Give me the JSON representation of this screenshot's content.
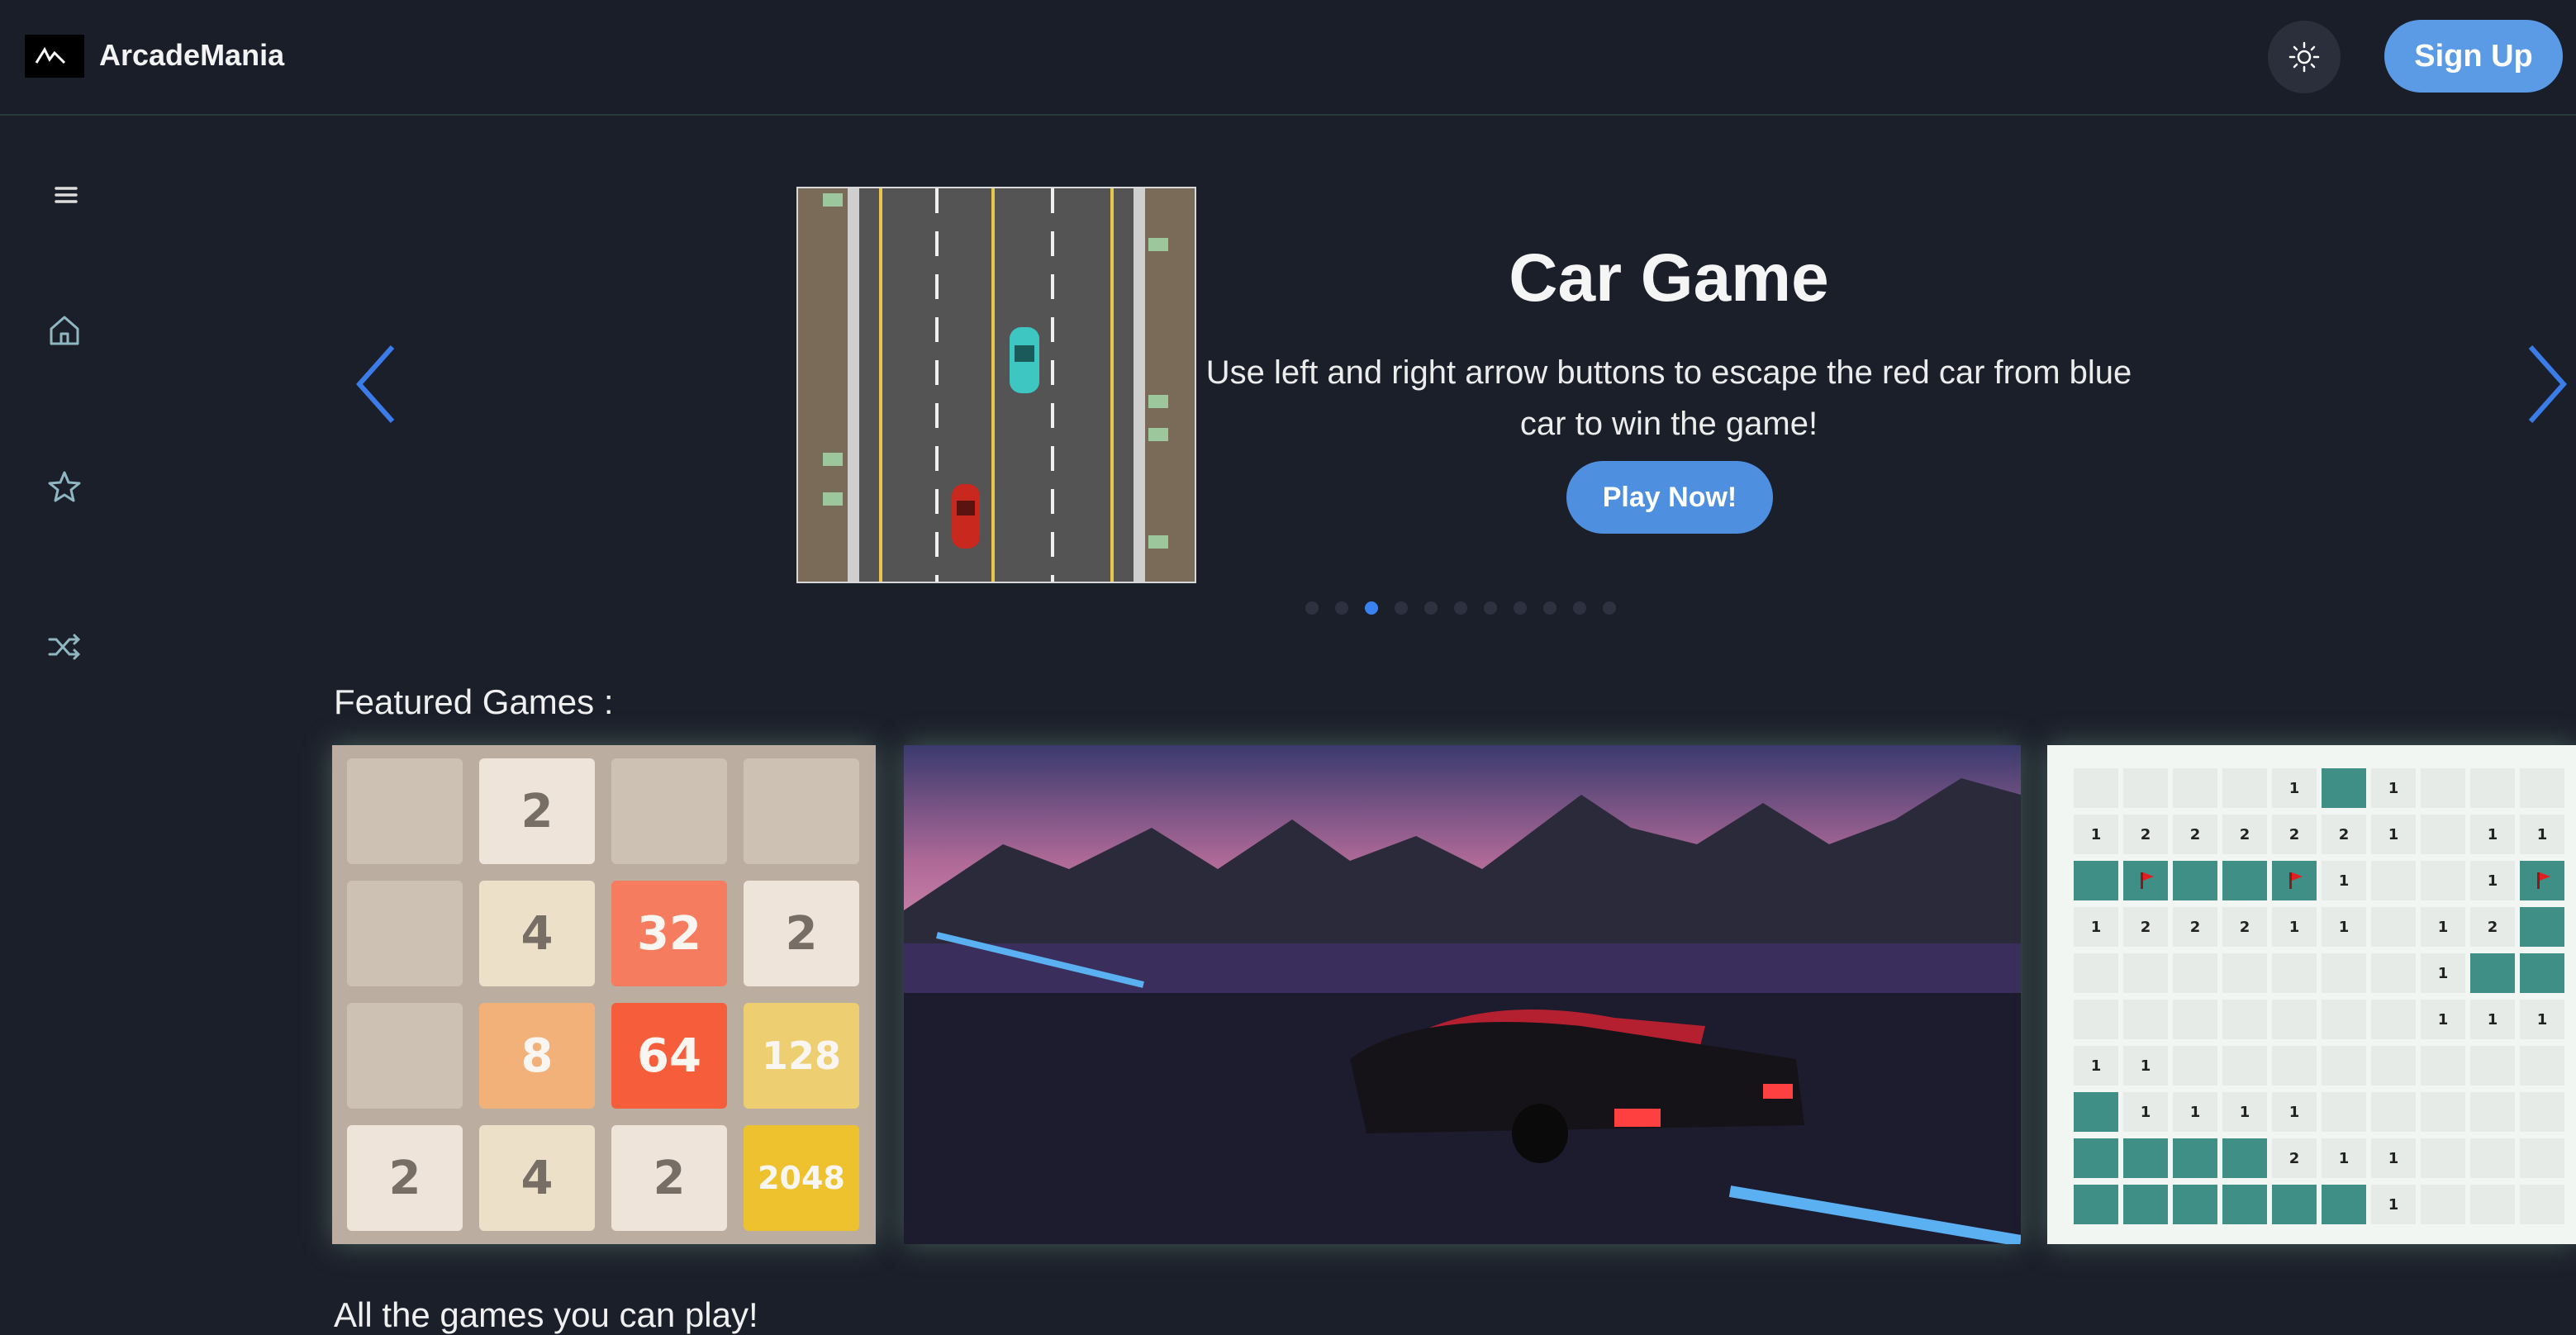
{
  "header": {
    "app_name": "ArcadeMania",
    "theme_toggle_icon": "sun-icon",
    "signup_label": "Sign Up"
  },
  "sidebar": {
    "items": [
      {
        "icon": "menu-icon"
      },
      {
        "icon": "home-icon"
      },
      {
        "icon": "star-icon"
      },
      {
        "icon": "shuffle-icon"
      }
    ]
  },
  "carousel": {
    "title": "Car Game",
    "description": "Use left and right arrow buttons to escape the red car from blue car to win the game!",
    "play_label": "Play Now!",
    "dot_count": 11,
    "active_dot": 2
  },
  "featured": {
    "label": "Featured Games :",
    "game_2048": {
      "tiles": [
        [
          "",
          "2",
          "",
          ""
        ],
        [
          "",
          "4",
          "32",
          "2"
        ],
        [
          "",
          "8",
          "64",
          "128"
        ],
        [
          "2",
          "4",
          "2",
          "2048"
        ]
      ]
    },
    "minesweeper": {
      "rows": [
        [
          "",
          "",
          "",
          "",
          "1",
          "#",
          "1",
          "",
          "",
          ""
        ],
        [
          "1",
          "2",
          "2",
          "2",
          "2",
          "2",
          "1",
          "",
          "1",
          "1"
        ],
        [
          "#",
          "F",
          "#",
          "#",
          "F",
          "1",
          "",
          "",
          "1",
          "F"
        ],
        [
          "1",
          "2",
          "2",
          "2",
          "1",
          "1",
          "",
          "1",
          "2",
          "#"
        ],
        [
          "",
          "",
          "",
          "",
          "",
          "",
          "",
          "1",
          "#",
          "#"
        ],
        [
          "",
          "",
          "",
          "",
          "",
          "",
          "",
          "1",
          "1",
          "1"
        ],
        [
          "1",
          "1",
          "",
          "",
          "",
          "",
          "",
          "",
          "",
          ""
        ],
        [
          "#",
          "1",
          "1",
          "1",
          "1",
          "",
          "",
          "",
          "",
          ""
        ],
        [
          "#",
          "#",
          "#",
          "#",
          "2",
          "1",
          "1",
          "",
          "",
          ""
        ],
        [
          "#",
          "#",
          "#",
          "#",
          "#",
          "#",
          "1",
          "",
          "",
          ""
        ]
      ]
    }
  },
  "all_games": {
    "label": "All the games you can play!"
  }
}
